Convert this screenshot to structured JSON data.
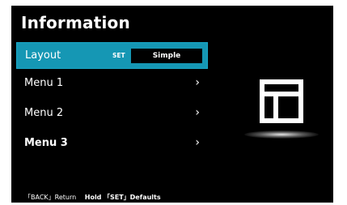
{
  "page": {
    "title": "Information"
  },
  "menu": {
    "items": [
      {
        "label": "Layout",
        "set_label": "SET",
        "value": "Simple",
        "selected": true
      },
      {
        "label": "Menu 1",
        "arrow": "›"
      },
      {
        "label": "Menu 2",
        "arrow": "›"
      },
      {
        "label": "Menu 3",
        "arrow": "›"
      }
    ]
  },
  "footer": {
    "back_text": "「BACK」Return",
    "hold_text": "Hold",
    "defaults_text": "「SET」Defaults"
  },
  "preview": {
    "icon": "layout-icon"
  },
  "colors": {
    "selected_row": "#1597b4",
    "screen_bg": "#000000",
    "text": "#ffffff"
  }
}
